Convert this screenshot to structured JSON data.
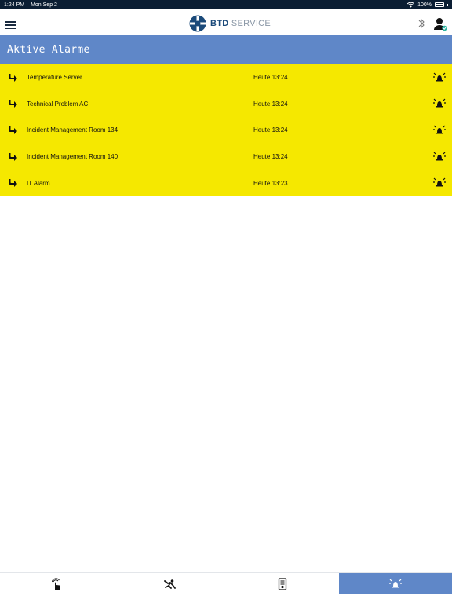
{
  "status_bar": {
    "time": "1:24 PM",
    "date": "Mon Sep 2",
    "battery": "100%"
  },
  "nav": {
    "brand": "BTD",
    "service": "SERVICE",
    "menu_icon": "hamburger-menu-icon",
    "bluetooth_icon": "bluetooth-icon",
    "user_icon": "user-verified-icon"
  },
  "header": {
    "title": "Aktive Alarme"
  },
  "alarms": [
    {
      "name": "Temperature Server",
      "time": "Heute 13:24"
    },
    {
      "name": "Technical Problem AC",
      "time": "Heute 13:24"
    },
    {
      "name": "Incident Management Room 134",
      "time": "Heute 13:24"
    },
    {
      "name": "Incident Management Room 140",
      "time": "Heute 13:24"
    },
    {
      "name": "IT Alarm",
      "time": "Heute 13:23"
    }
  ],
  "tabs": [
    {
      "icon": "touch-hand-icon",
      "active": false
    },
    {
      "icon": "person-falling-icon",
      "active": false
    },
    {
      "icon": "document-icon",
      "active": false
    },
    {
      "icon": "alarm-bell-icon",
      "active": true
    }
  ],
  "colors": {
    "accent": "#5f87c8",
    "alarm_background": "#f5e800",
    "status_bar": "#0b1e33",
    "brand": "#1b4a7a"
  }
}
